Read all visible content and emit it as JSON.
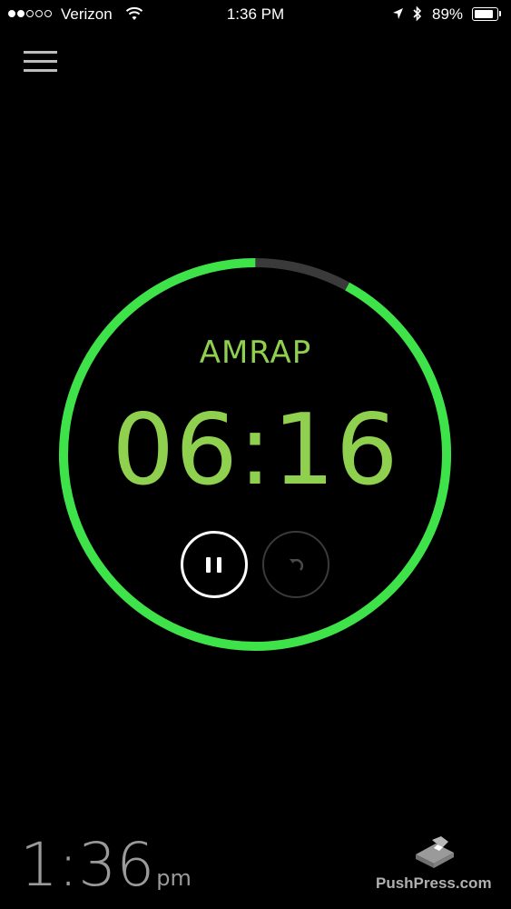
{
  "status_bar": {
    "carrier": "Verizon",
    "signal_bars_filled": 2,
    "signal_bars_total": 5,
    "time": "1:36 PM",
    "battery_percent": "89%",
    "battery_level": 0.89,
    "icons": [
      "wifi-icon",
      "location-arrow-icon",
      "bluetooth-icon",
      "battery-icon"
    ]
  },
  "menu": {
    "icon": "hamburger-menu-icon"
  },
  "timer": {
    "mode": "AMRAP",
    "display": "06:16",
    "progress_fraction": 0.92,
    "colors": {
      "progress": "#3ee34a",
      "progress_light": "#7ed957",
      "track": "#3a3a3a",
      "text": "#8fd14f"
    }
  },
  "controls": {
    "pause_icon": "pause-icon",
    "reset_icon": "reset-icon"
  },
  "footer": {
    "time": "1:36",
    "ampm": "pm",
    "brand": "PushPress.com",
    "logo_icon": "pushpress-logo-icon"
  }
}
